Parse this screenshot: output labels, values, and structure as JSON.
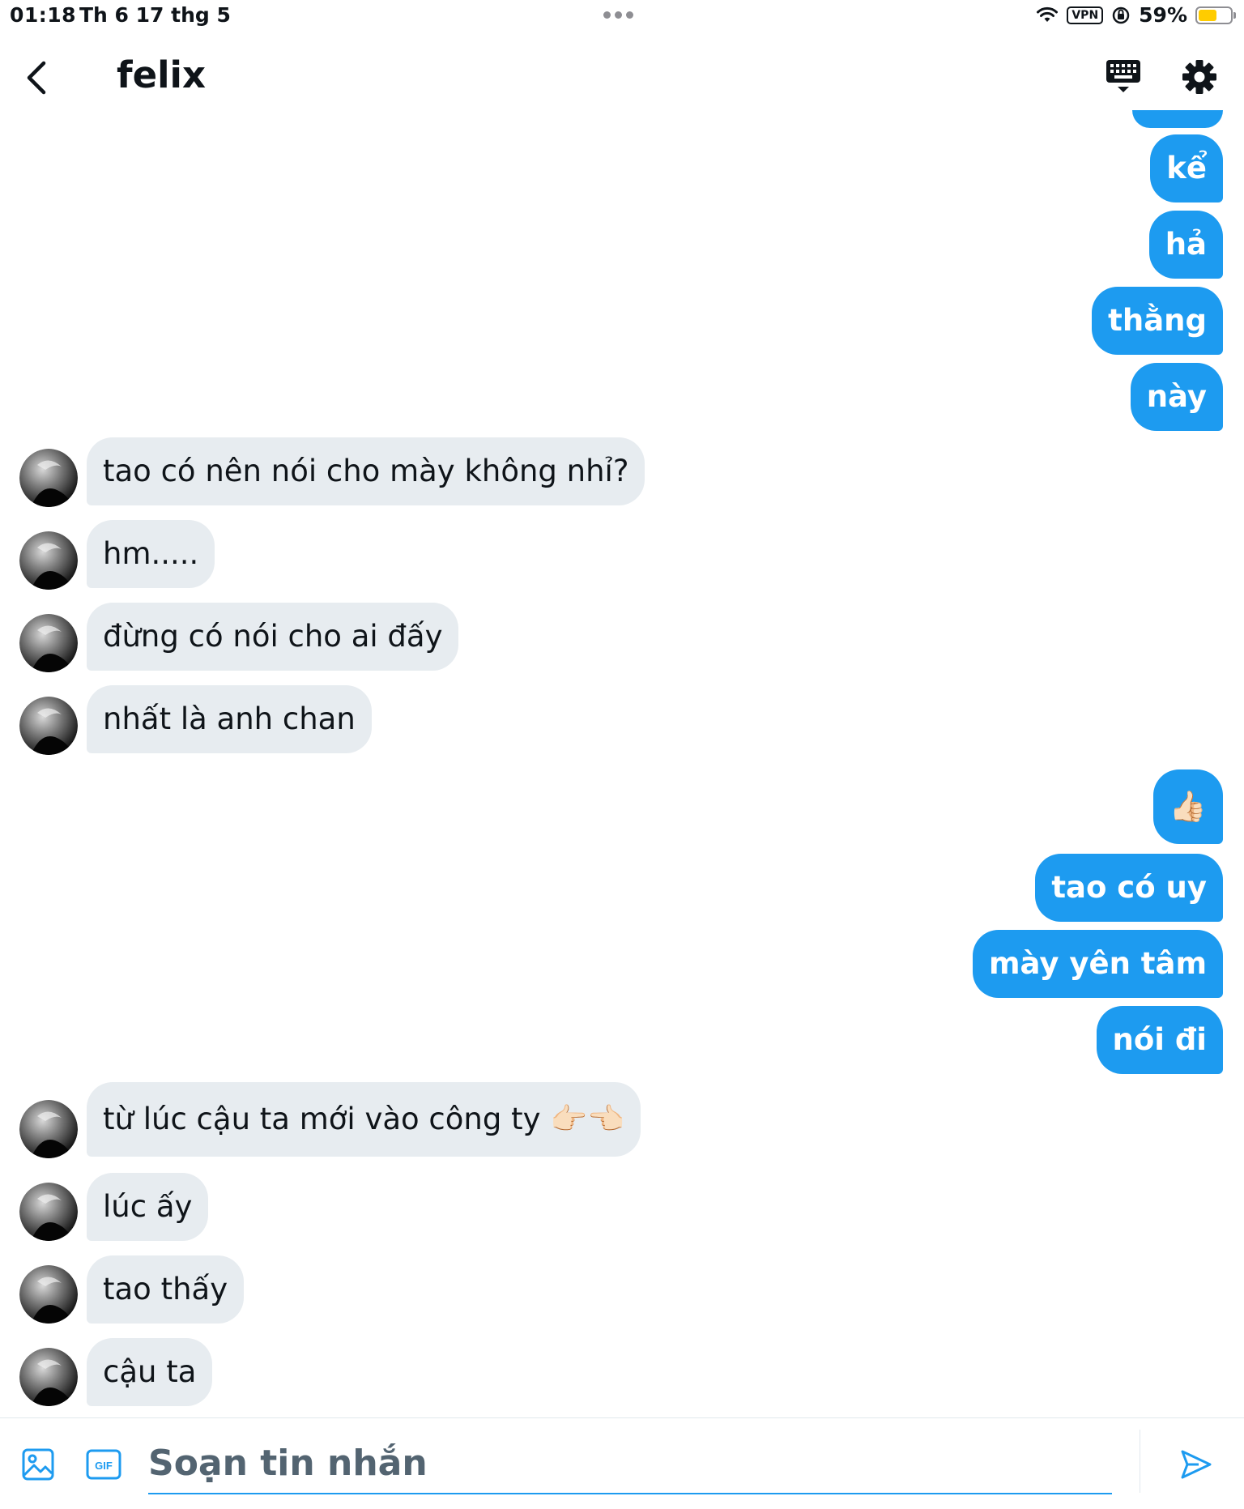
{
  "status_bar": {
    "time": "01:18",
    "date": "Th 6 17 thg 5",
    "vpn": "VPN",
    "battery": "59%",
    "battery_level": 0.59
  },
  "header": {
    "title": "felix"
  },
  "messages": [
    {
      "dir": "out",
      "text": "kể"
    },
    {
      "dir": "out",
      "text": "hả"
    },
    {
      "dir": "out",
      "text": "thằng"
    },
    {
      "dir": "out",
      "text": "này"
    },
    {
      "dir": "in",
      "text": "tao có nên nói cho mày không nhỉ?"
    },
    {
      "dir": "in",
      "text": "hm....."
    },
    {
      "dir": "in",
      "text": "đừng có nói cho ai đấy"
    },
    {
      "dir": "in",
      "text": "nhất là anh chan"
    },
    {
      "dir": "out",
      "text": "👍🏻"
    },
    {
      "dir": "out",
      "text": "tao có uy"
    },
    {
      "dir": "out",
      "text": "mày yên tâm"
    },
    {
      "dir": "out",
      "text": "nói đi"
    },
    {
      "dir": "in",
      "text": "từ lúc cậu ta mới vào công ty 👉🏻👈🏻"
    },
    {
      "dir": "in",
      "text": "lúc ấy"
    },
    {
      "dir": "in",
      "text": "tao thấy"
    },
    {
      "dir": "in",
      "text": "cậu ta"
    }
  ],
  "compose": {
    "placeholder": "Soạn tin nhắn",
    "gif_label": "GIF"
  },
  "colors": {
    "accent": "#1d9bf0",
    "incoming_bubble": "#e7ecf0"
  },
  "icons": [
    "back-arrow-icon",
    "keyboard-icon",
    "gear-icon",
    "image-icon",
    "gif-icon",
    "send-icon",
    "wifi-icon",
    "battery-icon"
  ]
}
